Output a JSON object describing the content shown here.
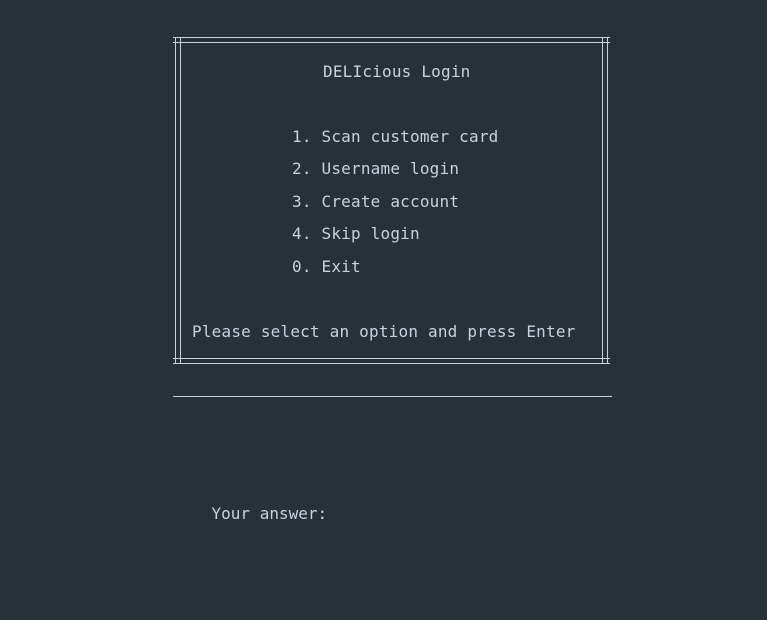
{
  "menu": {
    "title": "DELIcious Login",
    "items": [
      {
        "label": "1. Scan customer card"
      },
      {
        "label": "2. Username login"
      },
      {
        "label": "3. Create account"
      },
      {
        "label": "4. Skip login"
      },
      {
        "label": "0. Exit"
      }
    ],
    "instruction": "Please select an option and press Enter"
  },
  "prompt": {
    "label": "Your answer:"
  }
}
